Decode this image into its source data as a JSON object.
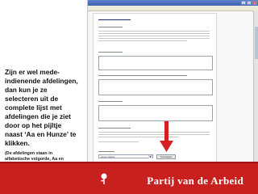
{
  "left": {
    "instruction": "Zijn er wel mede-\nindienende afdelingen,\ndan kun je ze\nselecteren uit de\ncomplete lijst met\nafdelingen die je ziet\ndoor op het pijltje\nnaast ‘Aa en Hunze’ te\nklikken.",
    "note": "(De afdelingen staan in\nalfabetische volgorde, Aa en\nHunze is de eerste van de lijst.)"
  },
  "browser": {
    "select_value": "Aa en Hunze",
    "add_button_label": "Toevoegen"
  },
  "footer": {
    "brand": "Partij van de Arbeid"
  },
  "colors": {
    "accent_red": "#c81f1f",
    "window_title_blue": "#3c62b2"
  }
}
